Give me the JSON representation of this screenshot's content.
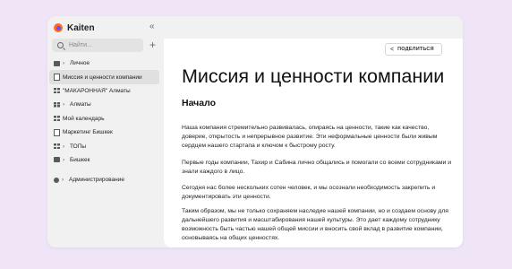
{
  "app": {
    "name": "Kaiten"
  },
  "search": {
    "placeholder": "Найти..."
  },
  "sidebar": {
    "items": [
      {
        "label": "Личное",
        "icon": "folder-icon",
        "chevron": true
      },
      {
        "label": "Миссия и ценности компании",
        "icon": "document-icon",
        "chevron": false,
        "active": true
      },
      {
        "label": "\"МАКАРОННАЯ\" Алматы",
        "icon": "board-icon",
        "chevron": false
      },
      {
        "label": "Алматы",
        "icon": "board-icon",
        "chevron": true
      },
      {
        "label": "Мой календарь",
        "icon": "board-icon",
        "chevron": false
      },
      {
        "label": "Маркетинг Бишкек",
        "icon": "document-icon",
        "chevron": false
      },
      {
        "label": "ТОПы",
        "icon": "board-icon",
        "chevron": true
      },
      {
        "label": "Бишкек",
        "icon": "folder-icon",
        "chevron": true
      },
      {
        "label": "Администрирование",
        "icon": "gear-icon",
        "chevron": true
      }
    ]
  },
  "toolbar": {
    "share_label": "ПОДЕЛИТЬСЯ"
  },
  "document": {
    "title": "Миссия и ценности компании",
    "heading": "Начало",
    "paragraphs": [
      "Наша компания стремительно развивалась, опираясь на ценности, такие как качество, доверие, открытость и непрерывное развитие. Эти неформальные ценности были живым сердцем нашего стартапа и ключом к быстрому росту.",
      "Первые годы компании, Тахир и Сабина лично общались и помогали со всеми сотрудниками и знали каждого в лицо.",
      "Сегодня нас более нескольких сотен человек, и мы осознали необходимость закрепить и документировать эти ценности.",
      "Таким образом, мы не только сохраняем наследие нашей компании, но и создаем основу для дальнейшего развития и масштабирования нашей культуры. Это дает каждому сотруднику возможность быть частью нашей общей миссии и вносить свой вклад в развитие компании, основываясь на общих ценностях."
    ]
  }
}
